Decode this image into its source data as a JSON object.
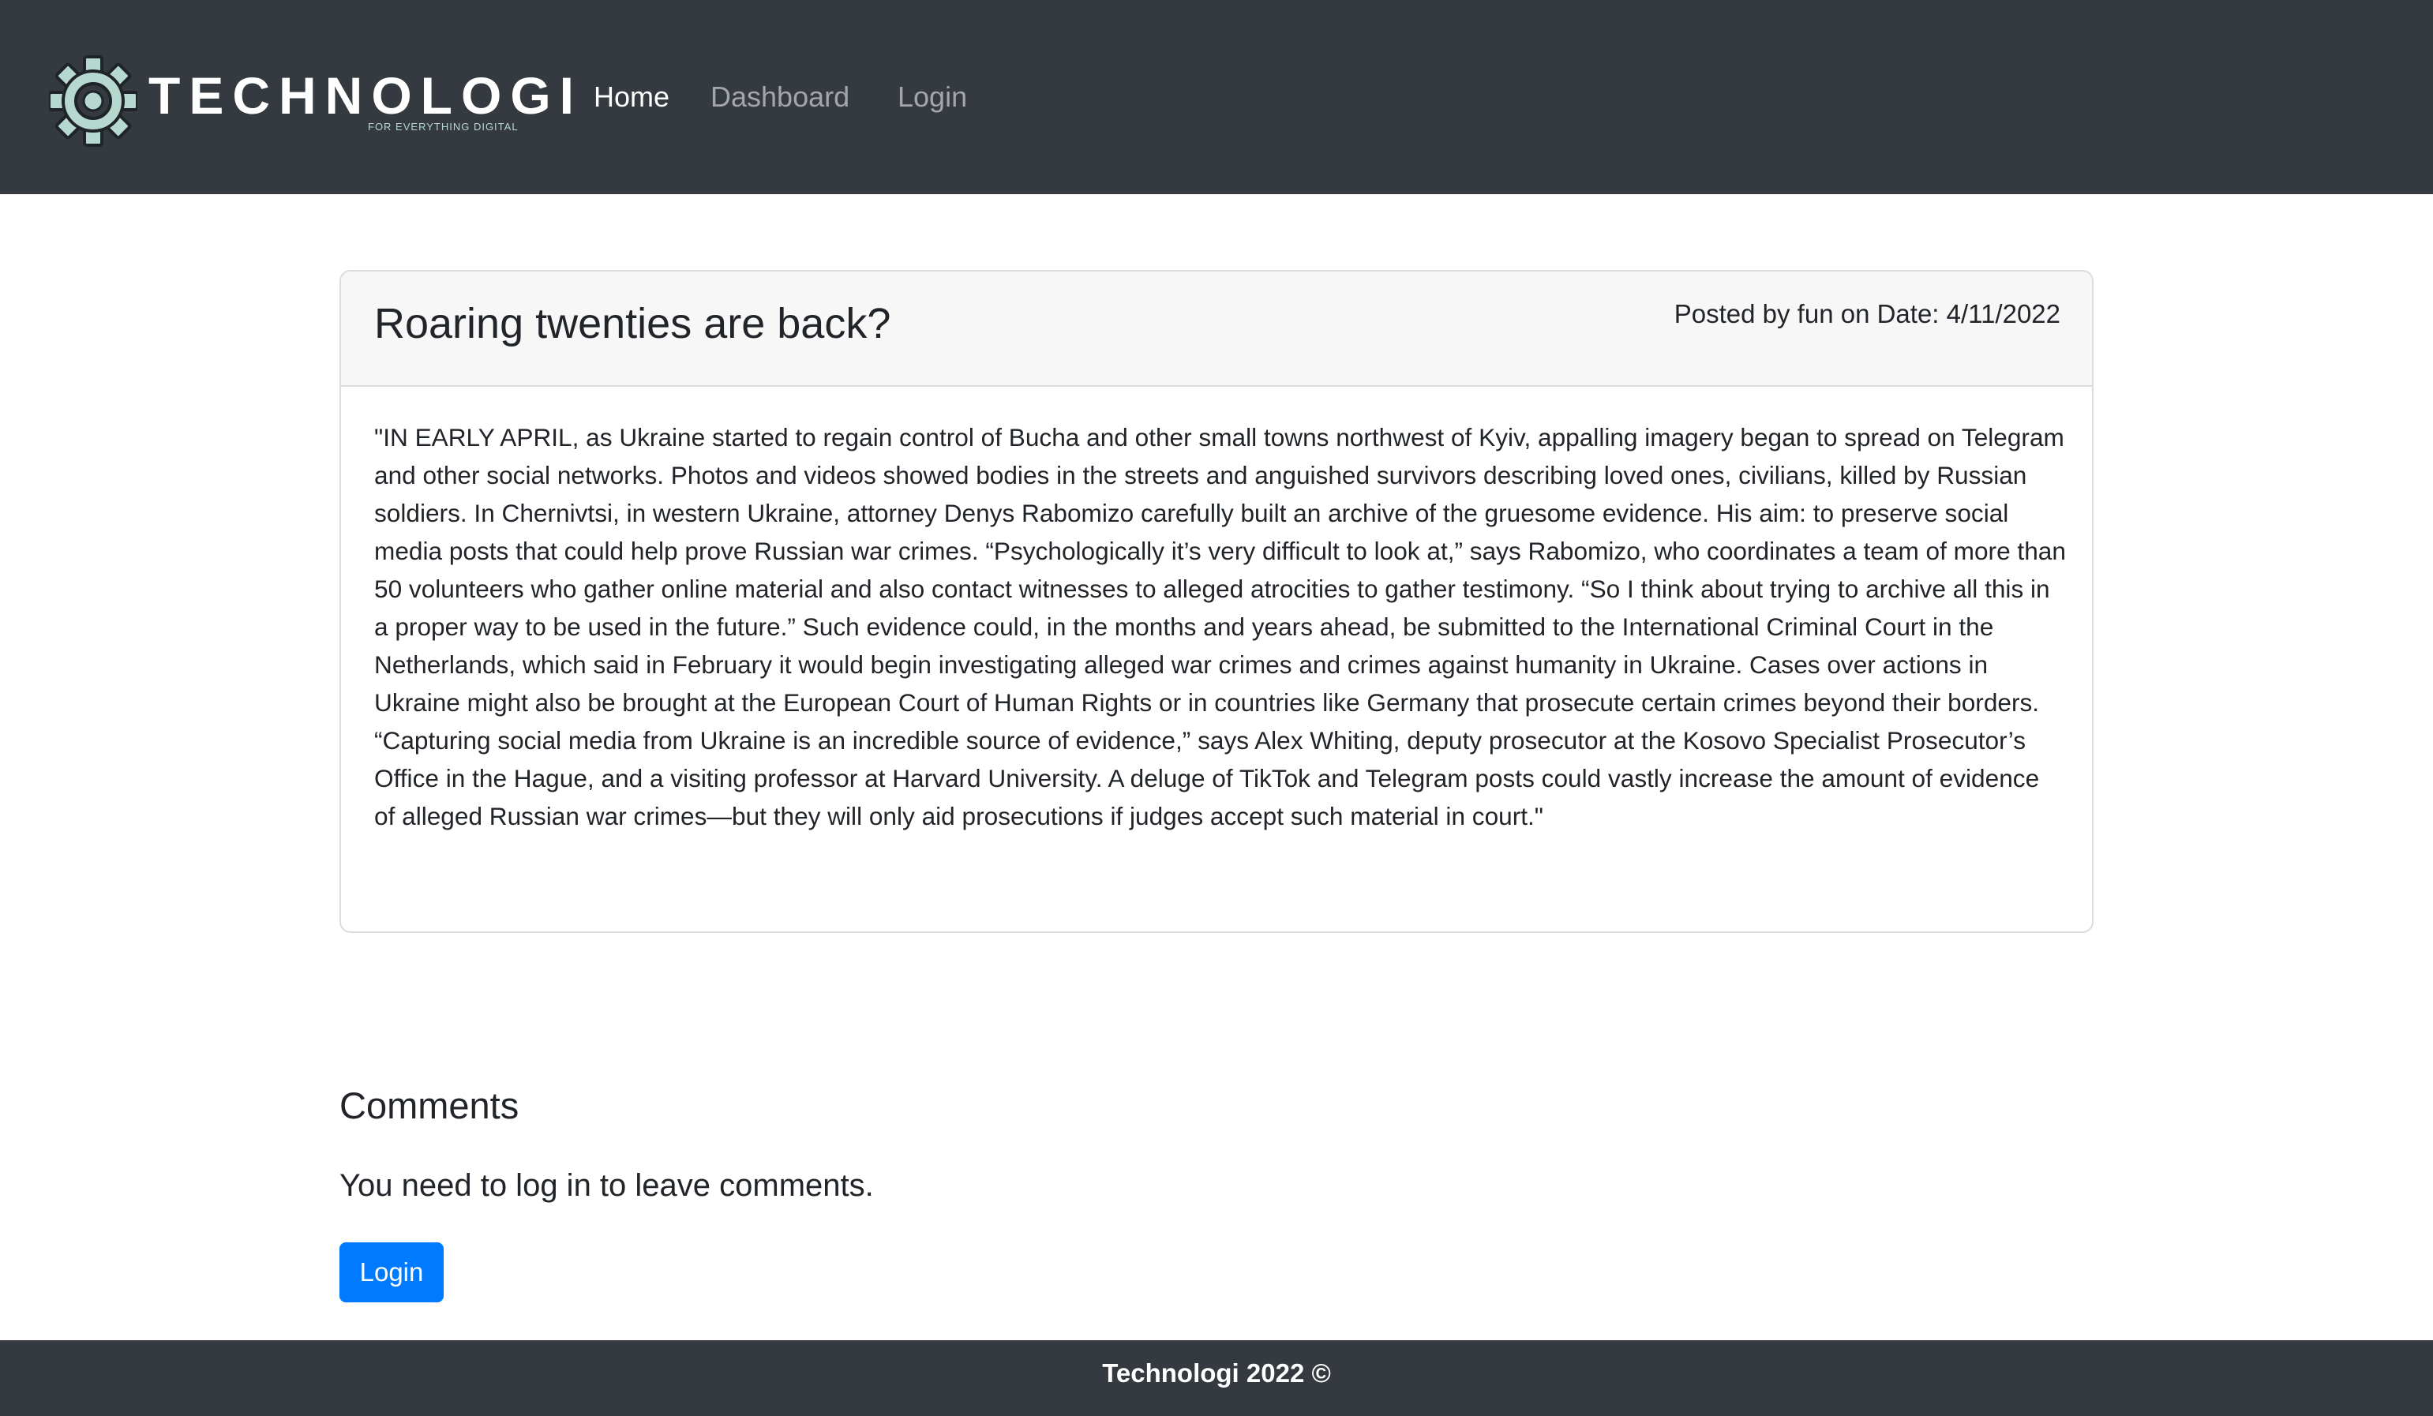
{
  "navbar": {
    "brand": {
      "name": "TECHNOLOGI",
      "tagline": "FOR EVERYTHING DIGITAL",
      "icon": "gear-icon",
      "icon_color": "#b6d8cf"
    },
    "links": [
      {
        "label": "Home",
        "active": true
      },
      {
        "label": "Dashboard",
        "active": false
      },
      {
        "label": "Login",
        "active": false
      }
    ],
    "background_color": "#343a40"
  },
  "post": {
    "title": "Roaring twenties are back?",
    "meta": "Posted by fun on Date: 4/11/2022",
    "body": "\"IN EARLY APRIL, as Ukraine started to regain control of Bucha and other small towns northwest of Kyiv, appalling imagery began to spread on Telegram and other social networks. Photos and videos showed bodies in the streets and anguished survivors describing loved ones, civilians, killed by Russian soldiers. In Chernivtsi, in western Ukraine, attorney Denys Rabomizo carefully built an archive of the gruesome evidence. His aim: to preserve social media posts that could help prove Russian war crimes. “Psychologically it’s very difficult to look at,” says Rabomizo, who coordinates a team of more than 50 volunteers who gather online material and also contact witnesses to alleged atrocities to gather testimony. “So I think about trying to archive all this in a proper way to be used in the future.” Such evidence could, in the months and years ahead, be submitted to the International Criminal Court in the Netherlands, which said in February it would begin investigating alleged war crimes and crimes against humanity in Ukraine. Cases over actions in Ukraine might also be brought at the European Court of Human Rights or in countries like Germany that prosecute certain crimes beyond their borders. “Capturing social media from Ukraine is an incredible source of evidence,” says Alex Whiting, deputy prosecutor at the Kosovo Specialist Prosecutor’s Office in the Hague, and a visiting professor at Harvard University. A deluge of TikTok and Telegram posts could vastly increase the amount of evidence of alleged Russian war crimes—but they will only aid prosecutions if judges accept such material in court.\""
  },
  "comments": {
    "title": "Comments",
    "notice": "You need to log in to leave comments.",
    "login_button": "Login",
    "button_color": "#007bff"
  },
  "footer": {
    "text": "Technologi 2022 ©"
  }
}
